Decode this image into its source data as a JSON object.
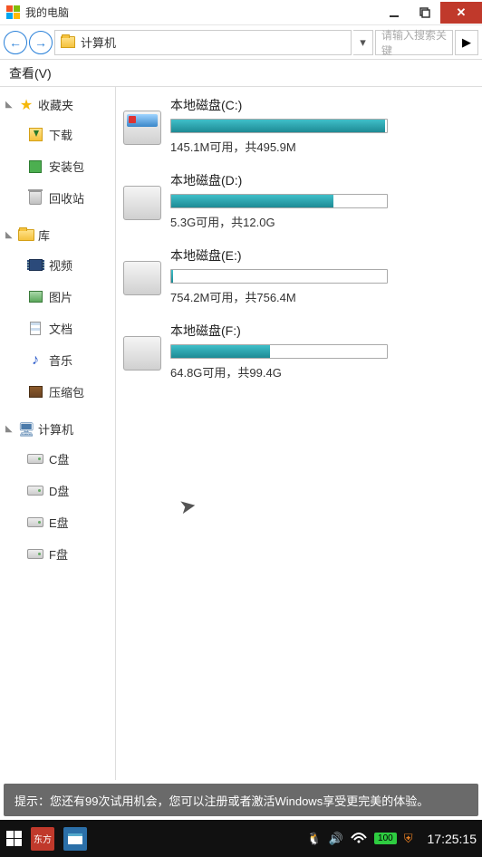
{
  "titlebar": {
    "title": "我的电脑"
  },
  "navbar": {
    "address": "计算机",
    "search_placeholder": "请输入搜索关键"
  },
  "menubar": {
    "view": "查看(V)"
  },
  "sidebar": {
    "favorites": {
      "label": "收藏夹",
      "items": [
        {
          "label": "下载"
        },
        {
          "label": "安装包"
        },
        {
          "label": "回收站"
        }
      ]
    },
    "library": {
      "label": "库",
      "items": [
        {
          "label": "视频"
        },
        {
          "label": "图片"
        },
        {
          "label": "文档"
        },
        {
          "label": "音乐"
        },
        {
          "label": "压缩包"
        }
      ]
    },
    "computer": {
      "label": "计算机",
      "items": [
        {
          "label": "C盘"
        },
        {
          "label": "D盘"
        },
        {
          "label": "E盘"
        },
        {
          "label": "F盘"
        }
      ]
    }
  },
  "drives": [
    {
      "name": "本地磁盘(C:)",
      "info": "145.1M可用，共495.9M",
      "pct": 99
    },
    {
      "name": "本地磁盘(D:)",
      "info": "5.3G可用，共12.0G",
      "pct": 75
    },
    {
      "name": "本地磁盘(E:)",
      "info": "754.2M可用，共756.4M",
      "pct": 1
    },
    {
      "name": "本地磁盘(F:)",
      "info": "64.8G可用，共99.4G",
      "pct": 46
    }
  ],
  "tip": "提示：您还有99次试用机会，您可以注册或者激活Windows享受更完美的体验。",
  "taskbar": {
    "df": "东方",
    "battery": "100",
    "clock": "17:25:15"
  }
}
